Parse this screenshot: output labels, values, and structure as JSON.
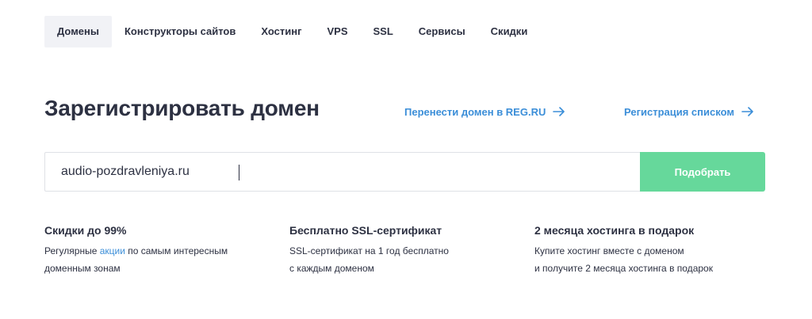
{
  "nav": {
    "items": [
      {
        "label": "Домены",
        "active": true
      },
      {
        "label": "Конструкторы сайтов",
        "active": false
      },
      {
        "label": "Хостинг",
        "active": false
      },
      {
        "label": "VPS",
        "active": false
      },
      {
        "label": "SSL",
        "active": false
      },
      {
        "label": "Сервисы",
        "active": false
      },
      {
        "label": "Скидки",
        "active": false
      }
    ]
  },
  "hero": {
    "title": "Зарегистрировать домен",
    "transfer_link": "Перенести домен в REG.RU",
    "bulk_link": "Регистрация списком",
    "link_icon": "arrow-right-icon"
  },
  "search": {
    "value": "audio-pozdravleniya.ru",
    "button_label": "Подобрать"
  },
  "features": [
    {
      "title": "Скидки до 99%",
      "text_before": "Регулярные ",
      "link": "акции",
      "text_after": " по самым интересным",
      "line2": "доменным зонам"
    },
    {
      "title": "Бесплатно SSL-сертификат",
      "line1": "SSL-сертификат на 1 год бесплатно",
      "line2": "с каждым доменом"
    },
    {
      "title": "2 месяца хостинга в подарок",
      "line1": "Купите хостинг вместе с доменом",
      "line2": "и получите 2 месяца хостинга в подарок"
    }
  ],
  "colors": {
    "accent_link": "#3b8ed8",
    "button": "#66d89b",
    "text": "#2d3142",
    "nav_active_bg": "#f1f2f6"
  }
}
